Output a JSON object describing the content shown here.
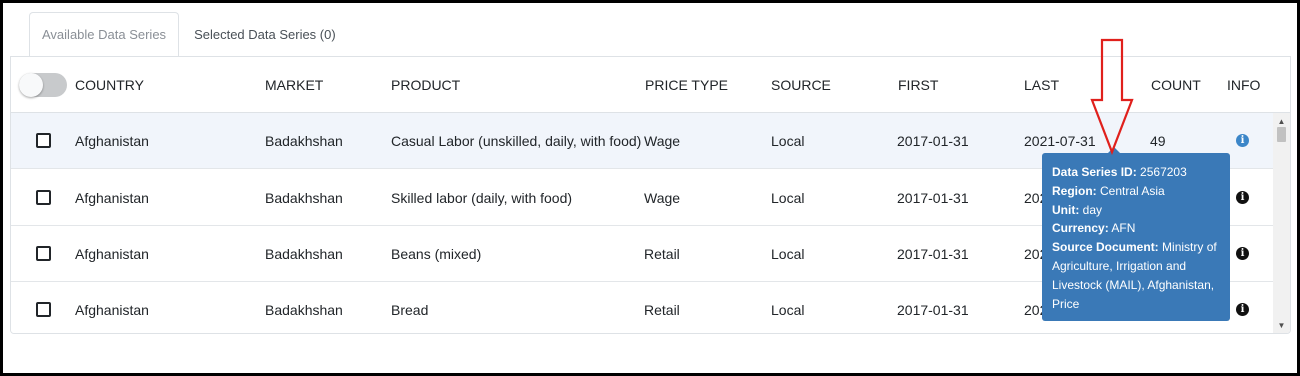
{
  "tabs": [
    {
      "label": "Available Data Series",
      "active": true
    },
    {
      "label": "Selected Data Series (0)",
      "active": false
    }
  ],
  "table": {
    "headers": [
      "COUNTRY",
      "MARKET",
      "PRODUCT",
      "PRICE TYPE",
      "SOURCE",
      "FIRST",
      "LAST",
      "COUNT",
      "INFO"
    ],
    "rows": [
      {
        "country": "Afghanistan",
        "market": "Badakhshan",
        "product": "Casual Labor (unskilled, daily, with food)",
        "price_type": "Wage",
        "source": "Local",
        "first": "2017-01-31",
        "last": "2021-07-31",
        "count": "49"
      },
      {
        "country": "Afghanistan",
        "market": "Badakhshan",
        "product": "Skilled labor (daily, with food)",
        "price_type": "Wage",
        "source": "Local",
        "first": "2017-01-31",
        "last": "202",
        "count": ""
      },
      {
        "country": "Afghanistan",
        "market": "Badakhshan",
        "product": "Beans (mixed)",
        "price_type": "Retail",
        "source": "Local",
        "first": "2017-01-31",
        "last": "202",
        "count": ""
      },
      {
        "country": "Afghanistan",
        "market": "Badakhshan",
        "product": "Bread",
        "price_type": "Retail",
        "source": "Local",
        "first": "2017-01-31",
        "last": "202",
        "count": ""
      }
    ]
  },
  "tooltip": {
    "series_id_label": "Data Series ID:",
    "series_id": "2567203",
    "region_label": "Region:",
    "region": "Central Asia",
    "unit_label": "Unit:",
    "unit": "day",
    "currency_label": "Currency:",
    "currency": "AFN",
    "source_doc_label": "Source Document:",
    "source_doc": "Ministry of Agriculture, Irrigation and Livestock (MAIL), Afghanistan, Price"
  },
  "icons": {
    "info": "info-circle-icon",
    "annotation": "red-down-arrow-icon"
  },
  "colors": {
    "tooltip_bg": "#3a79b7",
    "info_active": "#3c86c8",
    "annotation_arrow": "#e0201c",
    "row_highlight": "#f1f5fb"
  }
}
